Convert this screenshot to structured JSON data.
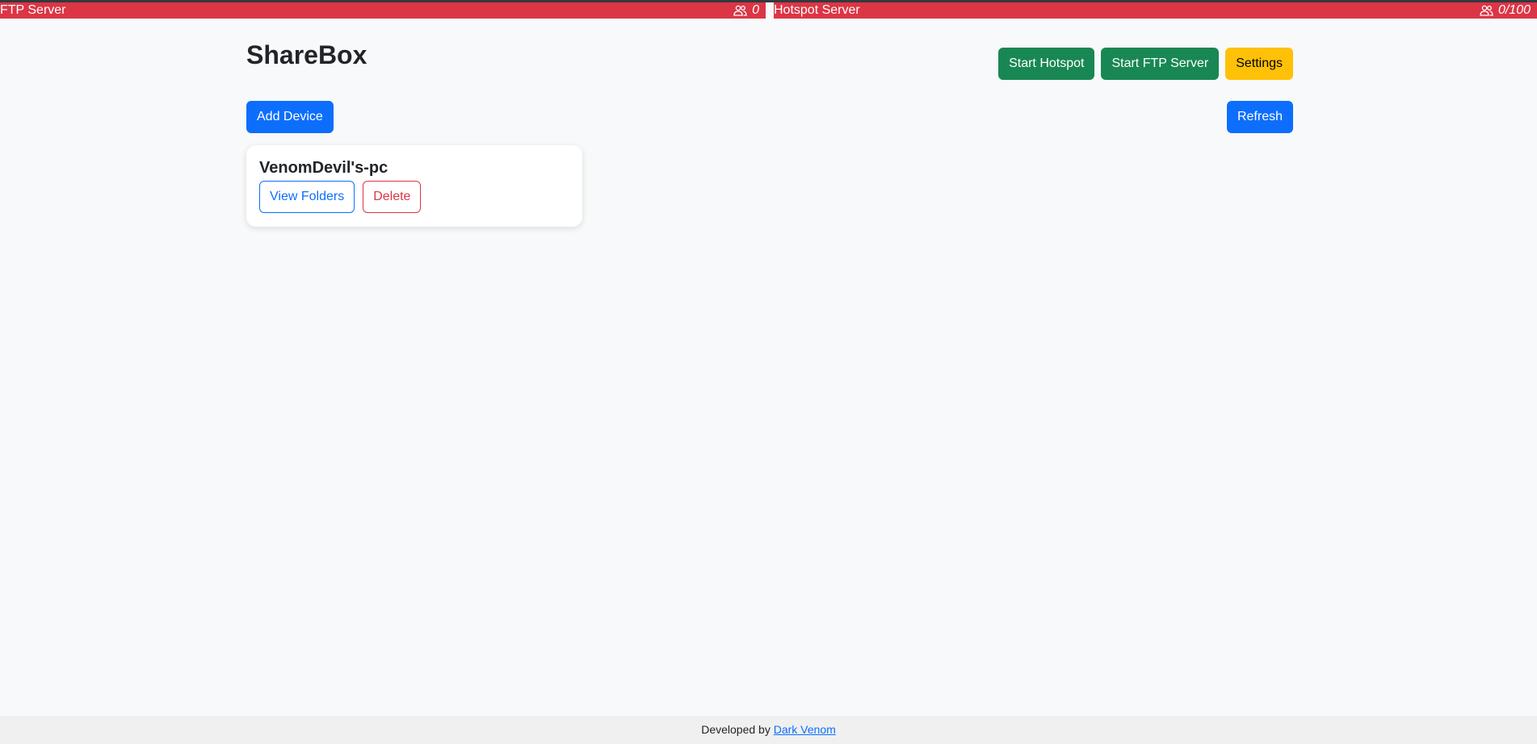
{
  "status_bars": {
    "ftp": {
      "name": "FTP Server",
      "count": "0",
      "color": "#dc3545"
    },
    "hotspot": {
      "name": "Hotspot Server",
      "count": "0/100",
      "color": "#dc3545"
    }
  },
  "header": {
    "title": "ShareBox",
    "start_hotspot_label": "Start Hotspot",
    "start_ftp_label": "Start FTP Server",
    "settings_label": "Settings"
  },
  "toolbar": {
    "add_device_label": "Add Device",
    "refresh_label": "Refresh"
  },
  "devices": [
    {
      "name": "VenomDevil's-pc",
      "view_folders_label": "View Folders",
      "delete_label": "Delete"
    }
  ],
  "footer": {
    "prefix": "Developed by",
    "author": "Dark Venom"
  },
  "colors": {
    "primary": "#0d6efd",
    "success": "#198754",
    "warning": "#ffc107",
    "danger": "#dc3545"
  }
}
